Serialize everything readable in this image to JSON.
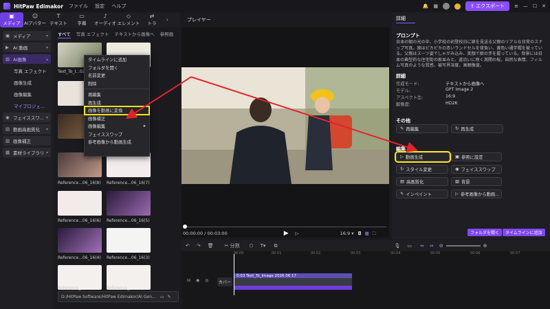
{
  "app": {
    "name": "HitPaw Edimakor",
    "menus": [
      "ファイル",
      "設定",
      "ヘルプ"
    ],
    "export_label": "エクスポート"
  },
  "toolbar": [
    {
      "label": "メディア",
      "icon": "folder-icon"
    },
    {
      "label": "AIアバター",
      "icon": "avatar-icon"
    },
    {
      "label": "テキスト",
      "icon": "text-icon"
    },
    {
      "label": "字幕",
      "icon": "subtitle-icon"
    },
    {
      "label": "オーディオ",
      "icon": "music-icon"
    },
    {
      "label": "エレメント",
      "icon": "element-icon"
    },
    {
      "label": "トラ",
      "icon": "transition-icon"
    }
  ],
  "sidebar": [
    {
      "label": "メディア"
    },
    {
      "label": "AI 動画"
    },
    {
      "label": "AI画像"
    },
    {
      "label": "写真 エフェクト"
    },
    {
      "label": "画像生成"
    },
    {
      "label": "画像編集"
    },
    {
      "label": "マイプロジェ..."
    },
    {
      "label": "フェイススワ..."
    },
    {
      "label": "動画高画質化"
    },
    {
      "label": "画像補正"
    },
    {
      "label": "素材ライブラリ"
    }
  ],
  "media_tabs": [
    "すべて",
    "写真 エフェクト",
    "テキストから画像へ",
    "参照画"
  ],
  "media_items": [
    "Text_To_I...026_06_17",
    "Reference...06_16(8)",
    "Reference...06_16(7)",
    "Reference...06_16(6)",
    "Reference...06_16(5)",
    "Reference...06_16(4)",
    "Reference...06_16(3)",
    "Reference_",
    "Reference_"
  ],
  "context_menu": [
    "タイムラインに追加",
    "フォルダを開く",
    "名前変更",
    "削除",
    "再編集",
    "再生成",
    "画像を動画に変換",
    "画像補正",
    "画像編集",
    "フェイススワップ",
    "参考画像から動画生成"
  ],
  "path": "D:/HitPaw Software/HitPaw Edimakor/AI Gen...",
  "player": {
    "title": "プレイヤー",
    "time": "00:00:00 / 00:03:00",
    "ratio": "16:9"
  },
  "details": {
    "tab": "詳細",
    "prompt_heading": "プロンプト",
    "prompt": "日本の朝の光の中、小学校の初登校日に娘を見送る父親のリアルな日常のスナップ写真。娘はピカピカの赤いランドセルを背負い、黄色い通学帽を被っている。父親はスーツ姿でしゃがみ込み、笑顔で娘の手を握っている。背景には日本の典型的な住宅街の家並みと、道沿いに咲く満開の桜。自然な表情、フィルム写真のような質感、被写界深度、高解像度。",
    "info_heading": "詳細",
    "info": [
      {
        "k": "作成モード:",
        "v": "テキストから画像へ"
      },
      {
        "k": "モデル:",
        "v": "GPT Image 2"
      },
      {
        "k": "アスペクト比:",
        "v": "16:9"
      },
      {
        "k": "解像度:",
        "v": "HD2K"
      }
    ],
    "other_heading": "その他",
    "reedit": "再編集",
    "regen": "再生成",
    "edit_heading": "編集",
    "edit_buttons": [
      "動画生成",
      "参照に設定",
      "スタイル変更",
      "フェイススワップ",
      "高画質化",
      "背景",
      "インペイント",
      "参考画像から動画..."
    ],
    "open_folder": "フォルダを開く",
    "add_timeline": "タイムラインに追加"
  },
  "timeline": {
    "split": "分割",
    "cover": "カバー",
    "clip_label": "0:03 Text_To_Image 2026 06 17",
    "ruler": [
      "00:00",
      "00:01",
      "00:02",
      "00:03",
      "00:04",
      "00:05",
      "00:06",
      "00:07"
    ]
  },
  "colors": {
    "accent": "#7f45f0",
    "highlight": "#ffe41a",
    "arrow": "#e0242c"
  }
}
